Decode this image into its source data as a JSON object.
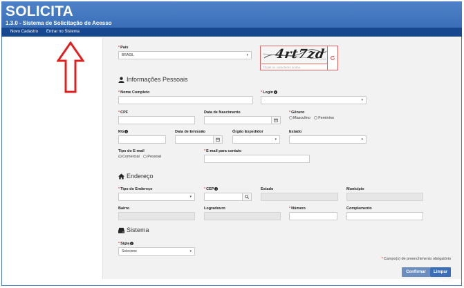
{
  "app": {
    "title": "SOLICITA",
    "subtitle": "1.3.0 - Sistema de Solicitação de Acesso"
  },
  "nav": {
    "items": [
      {
        "label": "Novo Cadastro"
      },
      {
        "label": "Entrar no Sistema"
      }
    ]
  },
  "form": {
    "pais": {
      "label": "País",
      "value": "BRASIL"
    },
    "captcha": {
      "text": "4rt7zd",
      "placeholder": "Digite os caracteres acima"
    },
    "sections": {
      "pessoal": "Informações Pessoais",
      "endereco": "Endereço",
      "sistema": "Sistema"
    },
    "nome_completo": {
      "label": "Nome Completo",
      "value": ""
    },
    "login": {
      "label": "Login",
      "value": ""
    },
    "cpf": {
      "label": "CPF",
      "value": ""
    },
    "data_nascimento": {
      "label": "Data de Nascimento",
      "value": ""
    },
    "genero": {
      "label": "Gênero",
      "options": [
        "Masculino",
        "Feminino"
      ],
      "selected": null
    },
    "rg": {
      "label": "RG",
      "value": ""
    },
    "data_emissao": {
      "label": "Data de Emissão",
      "value": ""
    },
    "orgao_expedidor": {
      "label": "Órgão Expedidor",
      "value": ""
    },
    "estado_rg": {
      "label": "Estado",
      "value": ""
    },
    "tipo_email": {
      "label": "Tipo do E-mail",
      "options": [
        "Comercial",
        "Pessoal"
      ],
      "selected": "Comercial"
    },
    "email_contato": {
      "label": "E-mail para contato",
      "value": ""
    },
    "tipo_endereco": {
      "label": "Tipo do Endereço",
      "value": ""
    },
    "cep": {
      "label": "CEP",
      "value": ""
    },
    "estado_end": {
      "label": "Estado",
      "value": ""
    },
    "municipio": {
      "label": "Município",
      "value": ""
    },
    "bairro": {
      "label": "Bairro",
      "value": ""
    },
    "logradouro": {
      "label": "Logradouro",
      "value": ""
    },
    "numero": {
      "label": "Número",
      "value": ""
    },
    "complemento": {
      "label": "Complemento",
      "value": ""
    },
    "sigla": {
      "label": "Sigla",
      "value": "Selecione"
    },
    "required_note": "Campo(s) de preenchimento obrigatório"
  },
  "buttons": {
    "confirm": "Confirmar",
    "clear": "Limpar"
  },
  "colors": {
    "header": "#3a6fb8",
    "navbar": "#17478e",
    "required": "#d9534f",
    "arrow": "#e02020"
  },
  "icons": [
    "user-icon",
    "home-icon",
    "hard-drive-icon",
    "calendar-icon",
    "search-icon",
    "refresh-icon",
    "info-icon",
    "chevron-down-icon",
    "up-arrow-annotation"
  ]
}
